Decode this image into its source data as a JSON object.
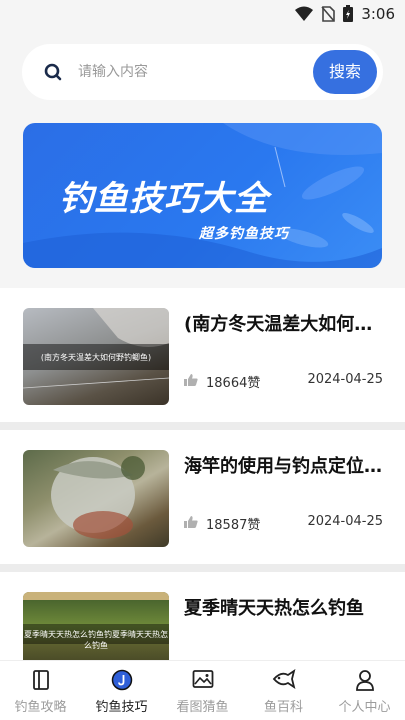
{
  "status_bar": {
    "time": "3:06"
  },
  "search": {
    "placeholder": "请输入内容",
    "button_label": "搜索"
  },
  "banner": {
    "title": "钓鱼技巧大全",
    "subtitle": "超多钓鱼技巧"
  },
  "articles": [
    {
      "title": "(南方冬天温差大如何野钓鲫鱼)",
      "thumb_caption": "(南方冬天温差大如何野钓鲫鱼)",
      "likes": "18664赞",
      "date": "2024-04-25"
    },
    {
      "title": "海竿的使用与钓点定位技巧",
      "likes": "18587赞",
      "date": "2024-04-25"
    },
    {
      "title": "夏季晴天天热怎么钓鱼",
      "thumb_caption": "夏季晴天天热怎么钓鱼钓夏季晴天天热怎么钓鱼"
    }
  ],
  "tabs": [
    {
      "label": "钓鱼攻略",
      "icon": "book-icon"
    },
    {
      "label": "钓鱼技巧",
      "icon": "fishing-skill-icon",
      "active": true
    },
    {
      "label": "看图猜鱼",
      "icon": "image-icon"
    },
    {
      "label": "鱼百科",
      "icon": "fish-icon"
    },
    {
      "label": "个人中心",
      "icon": "user-icon"
    }
  ],
  "colors": {
    "accent": "#3670e0",
    "banner": "#2b6ee6",
    "active_tab": "#2f5fd8"
  }
}
